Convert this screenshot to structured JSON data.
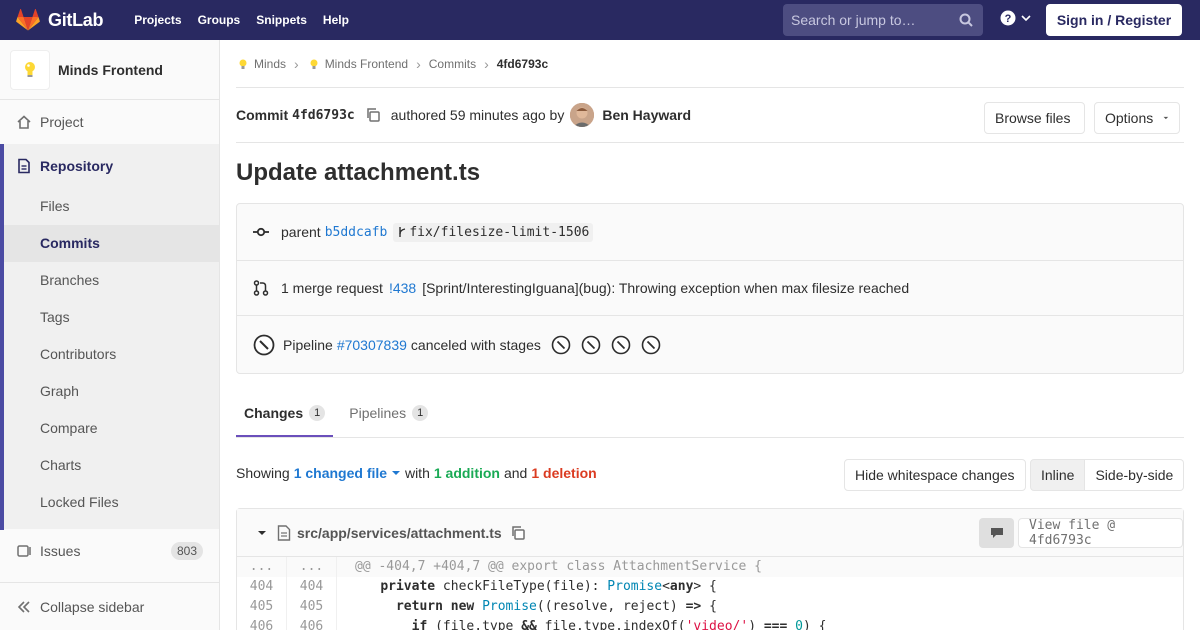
{
  "navbar": {
    "brand": "GitLab",
    "links": [
      "Projects",
      "Groups",
      "Snippets",
      "Help"
    ],
    "search_placeholder": "Search or jump to…",
    "sign_in": "Sign in / Register"
  },
  "sidebar": {
    "project_name": "Minds Frontend",
    "project": "Project",
    "repository": "Repository",
    "repo_items": [
      "Files",
      "Commits",
      "Branches",
      "Tags",
      "Contributors",
      "Graph",
      "Compare",
      "Charts",
      "Locked Files"
    ],
    "issues": "Issues",
    "issues_count": "803",
    "collapse": "Collapse sidebar"
  },
  "breadcrumbs": [
    "Minds",
    "Minds Frontend",
    "Commits",
    "4fd6793c"
  ],
  "commit": {
    "label": "Commit",
    "sha": "4fd6793c",
    "authored": "authored 59 minutes ago by",
    "author": "Ben Hayward",
    "browse_files": "Browse files",
    "options": "Options",
    "title": "Update attachment.ts"
  },
  "info": {
    "parent_label": "parent",
    "parent_sha": "b5ddcafb",
    "branch": "fix/filesize-limit-1506",
    "mr_label": "1 merge request",
    "mr_id": "!438",
    "mr_title": "[Sprint/InterestingIguana](bug): Throwing exception when max filesize reached",
    "pipeline_label": "Pipeline",
    "pipeline_id": "#70307839",
    "pipeline_status": "canceled with stages"
  },
  "tabs": [
    {
      "label": "Changes",
      "count": "1"
    },
    {
      "label": "Pipelines",
      "count": "1"
    }
  ],
  "summary": {
    "showing": "Showing",
    "changed": "1 changed file",
    "with": "with",
    "additions": "1 addition",
    "and": "and",
    "deletions": "1 deletion",
    "hide_ws": "Hide whitespace changes",
    "inline": "Inline",
    "side_by_side": "Side-by-side"
  },
  "file": {
    "path": "src/app/services/attachment.ts",
    "view_file": "View file @ 4fd6793c",
    "hunk_old": "...",
    "hunk_new": "...",
    "hunk": "@@ -404,7 +404,7 @@ export class AttachmentService {",
    "lines": [
      {
        "old": "404",
        "new": "404"
      },
      {
        "old": "405",
        "new": "405"
      },
      {
        "old": "406",
        "new": "406"
      }
    ]
  },
  "colors": {
    "navbar": "#292961",
    "accent": "#1f78d1",
    "addition": "#1aaa55",
    "deletion": "#db3b21"
  }
}
